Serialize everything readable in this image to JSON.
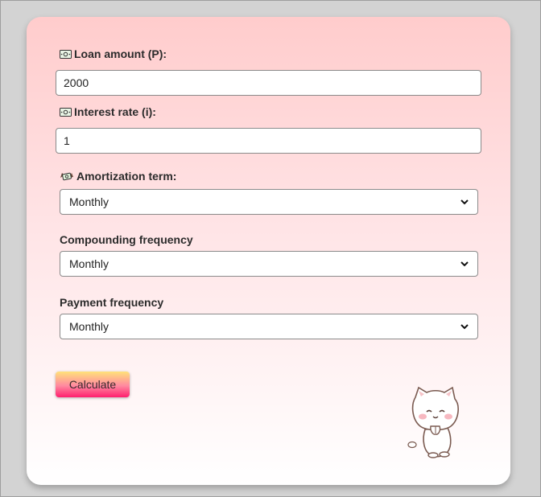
{
  "form": {
    "loan_amount": {
      "label": "Loan amount (P):",
      "value": "2000",
      "icon": "money-icon"
    },
    "interest_rate": {
      "label": "Interest rate (i):",
      "value": "1",
      "icon": "money-icon"
    },
    "amortization_term": {
      "label": "Amortization term:",
      "selected": "Monthly",
      "icon": "flying-money-icon"
    },
    "compounding_frequency": {
      "label": "Compounding frequency",
      "selected": "Monthly"
    },
    "payment_frequency": {
      "label": "Payment frequency",
      "selected": "Monthly"
    },
    "calculate_label": "Calculate"
  },
  "decoration": {
    "mascot": "cat-mascot-icon"
  },
  "colors": {
    "page_background": "#d3d3d3",
    "card_top": "#ffcccc",
    "card_bottom": "#ffffff",
    "button_top": "#ffe27a",
    "button_bottom": "#ff1f6e"
  }
}
